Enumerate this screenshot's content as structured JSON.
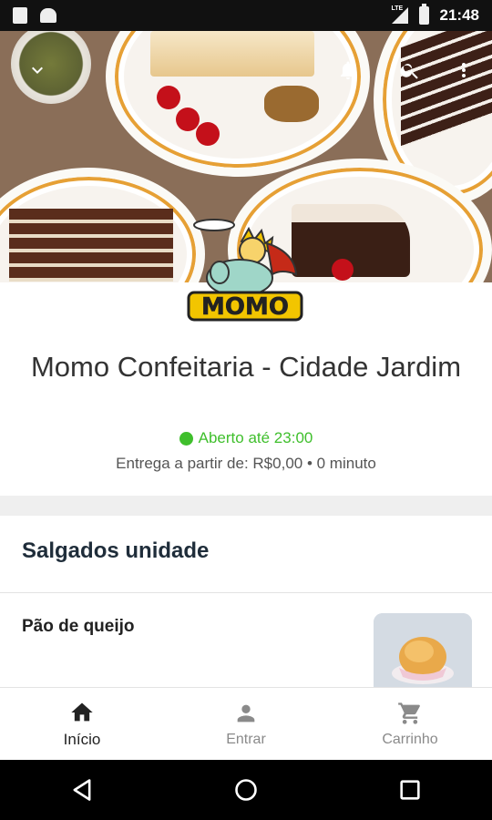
{
  "status_bar": {
    "time": "21:48",
    "network": "LTE"
  },
  "store": {
    "name": "Momo Confeitaria - Cidade Jardim",
    "logo_text": "MOMO",
    "open_status": "Aberto até 23:00",
    "delivery": "Entrega a partir de: R$0,00 • 0 minuto"
  },
  "section": {
    "title": "Salgados unidade"
  },
  "products": [
    {
      "name": "Pão de queijo"
    }
  ],
  "bottom_nav": {
    "items": [
      {
        "label": "Início",
        "icon": "home-icon",
        "active": true
      },
      {
        "label": "Entrar",
        "icon": "person-icon",
        "active": false
      },
      {
        "label": "Carrinho",
        "icon": "cart-icon",
        "active": false
      }
    ]
  },
  "colors": {
    "open": "#3fbf2c",
    "title": "#1f2d3a",
    "logo_yellow": "#f2c500"
  }
}
